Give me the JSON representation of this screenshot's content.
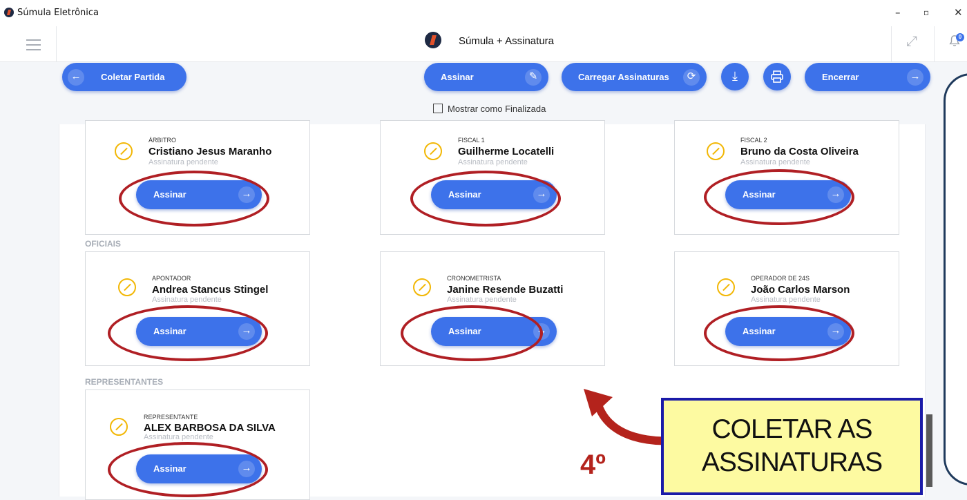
{
  "window": {
    "title": "Súmula Eletrônica",
    "controls": [
      "–",
      "▫",
      "✕"
    ]
  },
  "header": {
    "title": "Súmula + Assinatura",
    "notification_count": "0"
  },
  "toolbar": {
    "back_label": "Coletar Partida",
    "sign_label": "Assinar",
    "load_signatures_label": "Carregar Assinaturas",
    "close_label": "Encerrar",
    "show_finalized_label": "Mostrar como Finalizada"
  },
  "sections": {
    "oficiais": "OFICIAIS",
    "representantes": "REPRESENTANTES"
  },
  "cards": [
    {
      "role": "ÁRBITRO",
      "name": "Cristiano Jesus Maranho",
      "status": "Assinatura pendente",
      "button": "Assinar"
    },
    {
      "role": "FISCAL 1",
      "name": "Guilherme Locatelli",
      "status": "Assinatura pendente",
      "button": "Assinar"
    },
    {
      "role": "FISCAL 2",
      "name": "Bruno da Costa Oliveira",
      "status": "Assinatura pendente",
      "button": "Assinar"
    },
    {
      "role": "APONTADOR",
      "name": "Andrea Stancus Stingel",
      "status": "Assinatura pendente",
      "button": "Assinar"
    },
    {
      "role": "CRONOMETRISTA",
      "name": "Janine Resende Buzatti",
      "status": "Assinatura pendente",
      "button": "Assinar"
    },
    {
      "role": "OPERADOR DE 24S",
      "name": "João Carlos Marson",
      "status": "Assinatura pendente",
      "button": "Assinar"
    },
    {
      "role": "REPRESENTANTE",
      "name": "ALEX BARBOSA DA SILVA",
      "status": "Assinatura pendente",
      "button": "Assinar"
    }
  ],
  "annotation": {
    "callout_line1": "COLETAR AS",
    "callout_line2": "ASSINATURAS",
    "step": "4º"
  },
  "colors": {
    "primary": "#3d72ea",
    "highlight": "#b01f24",
    "callout_bg": "#fdfaa1",
    "callout_border": "#1a1aa8",
    "pen": "#f2b705"
  }
}
